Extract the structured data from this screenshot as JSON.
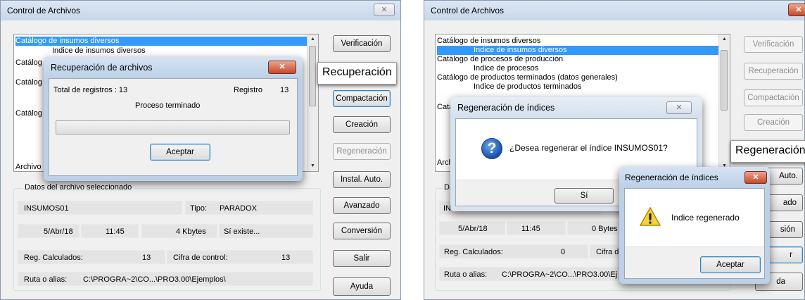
{
  "left_window": {
    "title": "Control de Archivos",
    "close_glyph": "✕",
    "file_list": [
      "Catálogo de insumos diversos",
      "Indice de insumos diversos",
      "Catálog",
      "Catálog",
      "Catálog",
      "Archivo"
    ],
    "buttons": {
      "verificacion": "Verificación",
      "compactacion": "Compactación",
      "creacion": "Creación",
      "regeneracion": "Regeneración",
      "instal_auto": "Instal. Auto.",
      "avanzado": "Avanzado",
      "conversion": "Conversión",
      "salir": "Salir",
      "ayuda": "Ayuda"
    },
    "callout": "Recuperación",
    "details": {
      "group_label": "Datos del archivo seleccionado",
      "name": "INSUMOS01",
      "type_label": "Tipo:",
      "type_value": "PARADOX",
      "date": "5/Abr/18",
      "time": "11:45",
      "size": "4 Kbytes",
      "exists": "Sí existe...",
      "reg_calc_label": "Reg. Calculados:",
      "reg_calc_value": "13",
      "cifra_label": "Cifra de control:",
      "cifra_value": "13",
      "ruta_label": "Ruta o alias:",
      "ruta_value": "C:\\PROGRA~2\\CO...\\PRO3.00\\Ejemplos\\"
    },
    "dialog": {
      "title": "Recuperación de archivos",
      "total_label": "Total de registros : 13",
      "registro_label": "Registro",
      "registro_value": "13",
      "status": "Proceso terminado",
      "progress": 0,
      "accept": "Aceptar"
    }
  },
  "right_window": {
    "title": "Control de Archivos",
    "close_glyph": "✕",
    "file_list": [
      "Catálogo de insumos diversos",
      "Indice de insumos diversos",
      "Catálogo de procesos de producción",
      "Indice de procesos",
      "Catálogo de productos terminados (datos generales)",
      "Indice de productos terminados",
      "Catá",
      "Arch"
    ],
    "buttons": {
      "verificacion": "Verificación",
      "recuperacion": "Recuperación",
      "compactacion": "Compactación",
      "creacion": "Creación",
      "instal_auto": "Auto.",
      "btn_ado": "ado",
      "btn_sion": "sión",
      "btn_r": "r",
      "btn_da": "da"
    },
    "callout": "Regeneración",
    "details": {
      "group_label": "Da",
      "name": "INS",
      "date": "5/Abr/18",
      "time": "11:45",
      "size": "0 Bytes",
      "reg_calc_label": "Reg. Calculados:",
      "reg_calc_value": "0",
      "cifra_label": "Cifra de c",
      "ruta_label": "Ruta o alias:",
      "ruta_value": "C:\\PROGRA~2\\CO...\\PRO3.00\\Ej"
    },
    "dialog_question": {
      "title": "Regeneración de índices",
      "question": "¿Desea regenerar el índice INSUMOS01?",
      "yes": "Sí",
      "icon": "question-icon"
    },
    "dialog_info": {
      "title": "Regeneración de índices",
      "message": "Indice regenerado",
      "accept": "Aceptar",
      "icon": "warning-icon"
    }
  }
}
